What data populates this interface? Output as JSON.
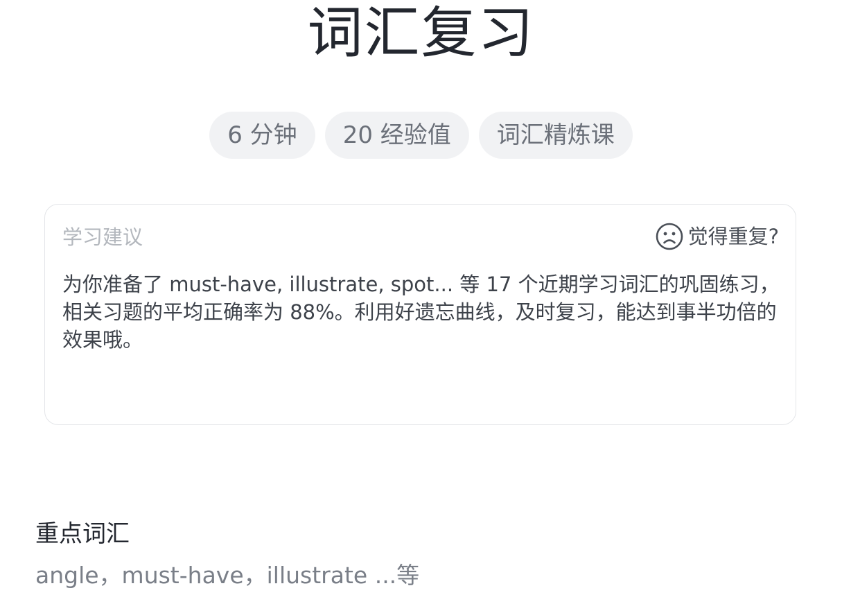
{
  "page_title": "词汇复习",
  "tags": [
    "6 分钟",
    "20 经验值",
    "词汇精炼课"
  ],
  "advice": {
    "label": "学习建议",
    "feedback_label": "觉得重复?",
    "feedback_icon": "frown-face-icon",
    "text": "为你准备了 must-have, illustrate, spot... 等 17 个近期学习词汇的巩固练习，相关习题的平均正确率为 88%。利用好遗忘曲线，及时复习，能达到事半功倍的效果哦。"
  },
  "key_vocab": {
    "title": "重点词汇",
    "words": "angle，must-have，illustrate ...等"
  }
}
